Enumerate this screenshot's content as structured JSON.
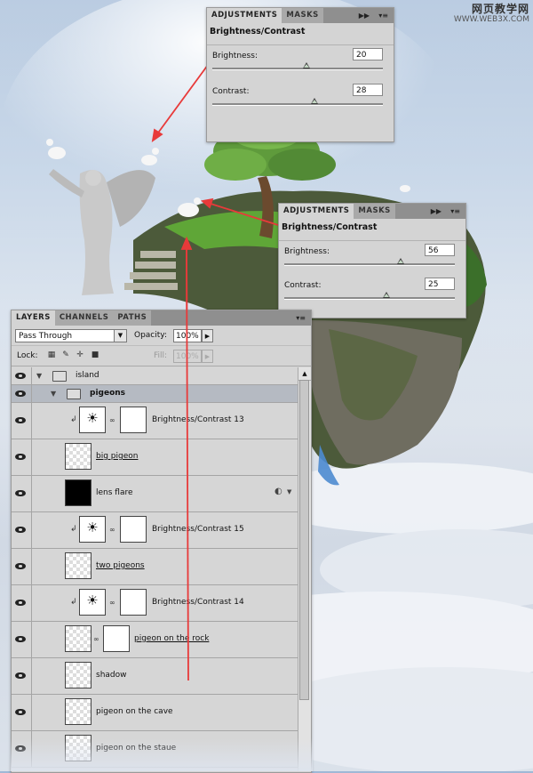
{
  "watermark": {
    "line1": "网页教学网",
    "line2": "WWW.WEB3X.COM"
  },
  "panel_adj1": {
    "tabs": [
      "ADJUSTMENTS",
      "MASKS"
    ],
    "title": "Brightness/Contrast",
    "brightness_label": "Brightness:",
    "brightness_value": "20",
    "brightness_level": 0.55,
    "contrast_label": "Contrast:",
    "contrast_value": "28",
    "contrast_level": 0.6
  },
  "panel_adj2": {
    "tabs": [
      "ADJUSTMENTS",
      "MASKS"
    ],
    "title": "Brightness/Contrast",
    "brightness_label": "Brightness:",
    "brightness_value": "56",
    "brightness_level": 0.68,
    "contrast_label": "Contrast:",
    "contrast_value": "25",
    "contrast_level": 0.6
  },
  "layers_panel": {
    "tabs": [
      "LAYERS",
      "CHANNELS",
      "PATHS"
    ],
    "blend_mode": "Pass Through",
    "opacity_label": "Opacity:",
    "opacity_value": "100%",
    "lock_label": "Lock:",
    "fill_label": "Fill:",
    "fill_value": "100%",
    "layers": [
      {
        "name": "island",
        "kind": "group"
      },
      {
        "name": "pigeons",
        "kind": "group"
      },
      {
        "name": "Brightness/Contrast 13",
        "kind": "adjustment"
      },
      {
        "name": "big pigeon",
        "kind": "smart"
      },
      {
        "name": "lens flare",
        "kind": "black"
      },
      {
        "name": "Brightness/Contrast 15",
        "kind": "adjustment"
      },
      {
        "name": "two pigeons",
        "kind": "smart"
      },
      {
        "name": "Brightness/Contrast 14",
        "kind": "adjustment"
      },
      {
        "name": "pigeon on the rock",
        "kind": "smart-mask"
      },
      {
        "name": "shadow",
        "kind": "plain"
      },
      {
        "name": "pigeon on the cave",
        "kind": "smart"
      },
      {
        "name": "pigeon on the staue",
        "kind": "smart"
      }
    ]
  },
  "colors": {
    "annotation_arrow": "#e83a3a",
    "panel_bg": "#d4d4d4",
    "selected_row": "#b5bac2"
  }
}
